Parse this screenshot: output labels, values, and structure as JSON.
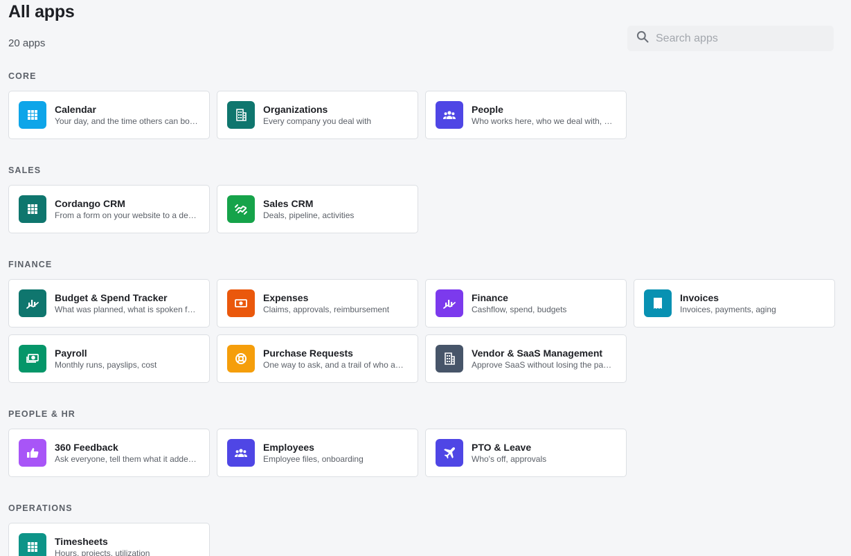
{
  "header": {
    "title": "All apps",
    "count_label": "20 apps"
  },
  "search": {
    "placeholder": "Search apps",
    "value": "",
    "icon": "search-icon"
  },
  "sections": [
    {
      "title": "CORE",
      "apps": [
        {
          "name": "Calendar",
          "description": "Your day, and the time others can book with you",
          "icon": "grid-icon",
          "color": "#0ea5e9"
        },
        {
          "name": "Organizations",
          "description": "Every company you deal with",
          "icon": "building-icon",
          "color": "#0f766e"
        },
        {
          "name": "People",
          "description": "Who works here, who we deal with, and how to reach them",
          "icon": "people-icon",
          "color": "#4f46e5"
        }
      ]
    },
    {
      "title": "SALES",
      "apps": [
        {
          "name": "Cordango CRM",
          "description": "From a form on your website to a deal in your pipeline",
          "icon": "grid-icon",
          "color": "#0f766e"
        },
        {
          "name": "Sales CRM",
          "description": "Deals, pipeline, activities",
          "icon": "handshake-icon",
          "color": "#16a34a"
        }
      ]
    },
    {
      "title": "FINANCE",
      "apps": [
        {
          "name": "Budget & Spend Tracker",
          "description": "What was planned, what is spoken for, what is left",
          "icon": "chart-icon",
          "color": "#0f766e"
        },
        {
          "name": "Expenses",
          "description": "Claims, approvals, reimbursement",
          "icon": "money-icon",
          "color": "#ea580c"
        },
        {
          "name": "Finance",
          "description": "Cashflow, spend, budgets",
          "icon": "chart-icon",
          "color": "#7c3aed"
        },
        {
          "name": "Invoices",
          "description": "Invoices, payments, aging",
          "icon": "receipt-icon",
          "color": "#0891b2"
        },
        {
          "name": "Payroll",
          "description": "Monthly runs, payslips, cost",
          "icon": "cash-icon",
          "color": "#059669"
        },
        {
          "name": "Purchase Requests",
          "description": "One way to ask, and a trail of who approved what",
          "icon": "lifebuoy-icon",
          "color": "#f59e0b"
        },
        {
          "name": "Vendor & SaaS Management",
          "description": "Approve SaaS without losing the paper trail",
          "icon": "building-icon",
          "color": "#475569"
        }
      ]
    },
    {
      "title": "PEOPLE & HR",
      "apps": [
        {
          "name": "360 Feedback",
          "description": "Ask everyone, tell them what it added up to",
          "icon": "thumbs-up-icon",
          "color": "#a855f7"
        },
        {
          "name": "Employees",
          "description": "Employee files, onboarding",
          "icon": "people-icon",
          "color": "#4f46e5"
        },
        {
          "name": "PTO & Leave",
          "description": "Who's off, approvals",
          "icon": "plane-icon",
          "color": "#4f46e5"
        }
      ]
    },
    {
      "title": "OPERATIONS",
      "apps": [
        {
          "name": "Timesheets",
          "description": "Hours, projects, utilization",
          "icon": "grid-icon",
          "color": "#0d9488"
        }
      ]
    }
  ]
}
